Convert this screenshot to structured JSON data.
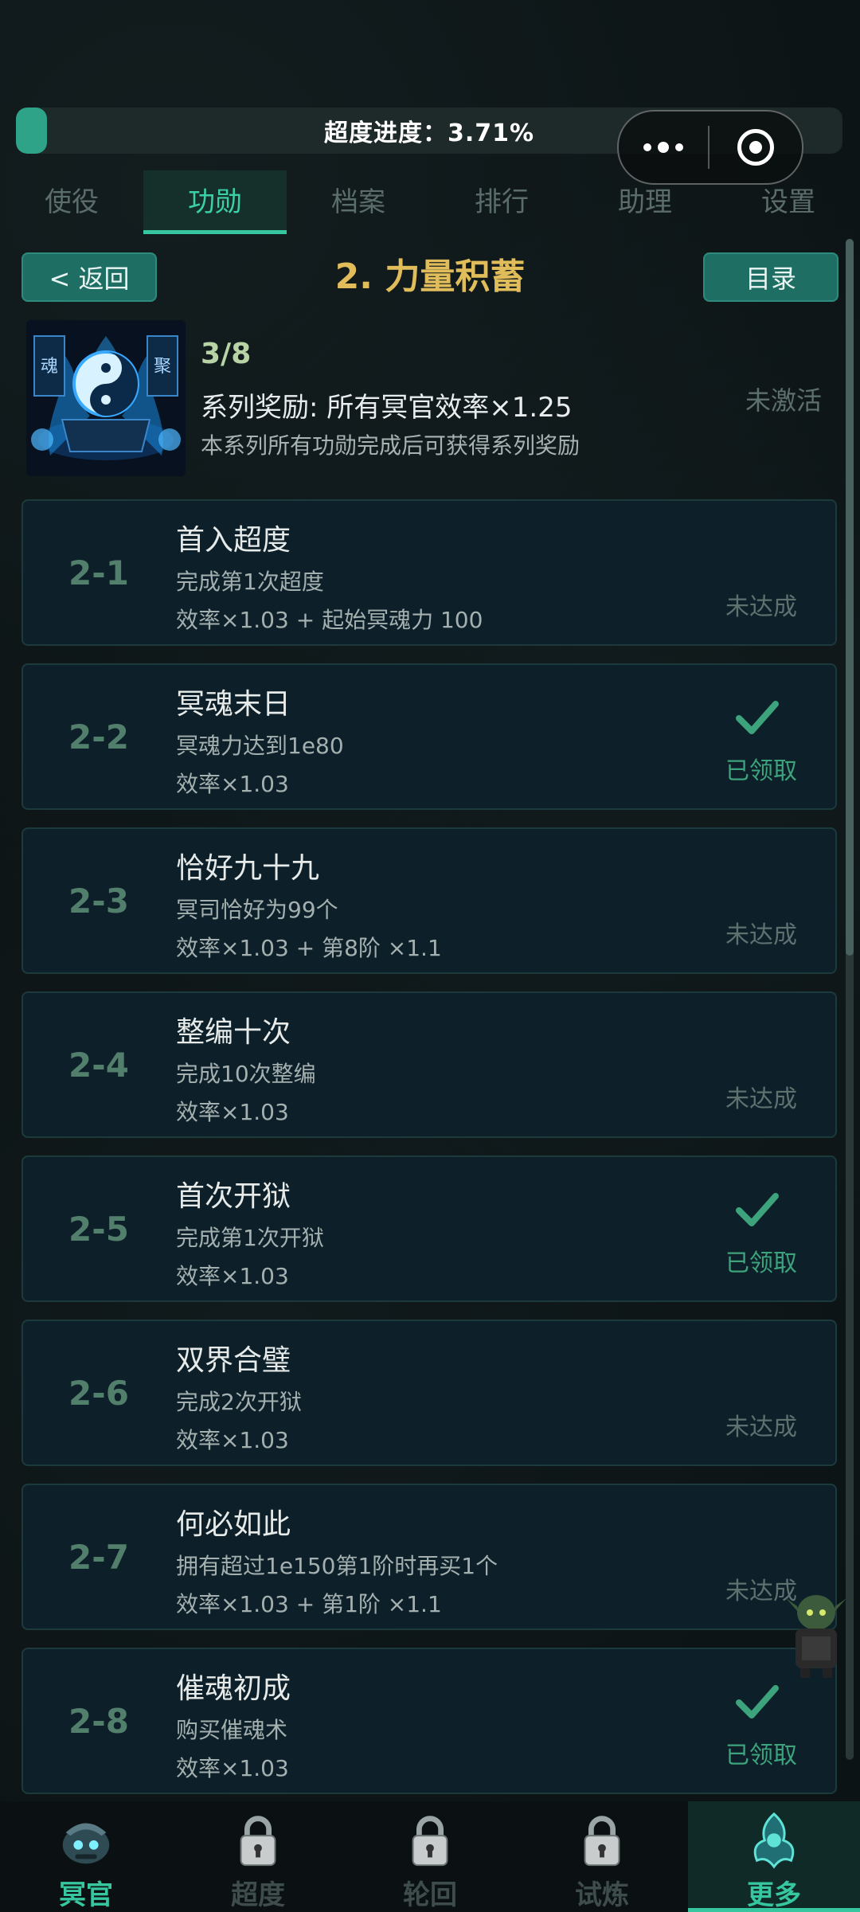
{
  "progress": {
    "label": "超度进度：3.71%",
    "value_percent": 3.71
  },
  "tabs": [
    {
      "label": "使役",
      "active": false
    },
    {
      "label": "功勋",
      "active": true
    },
    {
      "label": "档案",
      "active": false
    },
    {
      "label": "排行",
      "active": false
    },
    {
      "label": "助理",
      "active": false
    },
    {
      "label": "设置",
      "active": false
    }
  ],
  "header": {
    "back_label": "< 返回",
    "title": "2. 力量积蓄",
    "menu_label": "目录"
  },
  "series": {
    "count": "3/8",
    "reward": "系列奖励: 所有冥官效率×1.25",
    "note": "本系列所有功勋完成后可获得系列奖励",
    "status": "未激活",
    "image_glyphs": [
      "魂",
      "聚"
    ]
  },
  "achievements": [
    {
      "id": "2-1",
      "title": "首入超度",
      "desc": "完成第1次超度",
      "reward": "效率×1.03 + 起始冥魂力 100",
      "status": "未达成",
      "claimed": false
    },
    {
      "id": "2-2",
      "title": "冥魂末日",
      "desc": "冥魂力达到1e80",
      "reward": "效率×1.03",
      "status": "已领取",
      "claimed": true
    },
    {
      "id": "2-3",
      "title": "恰好九十九",
      "desc": "冥司恰好为99个",
      "reward": "效率×1.03 + 第8阶 ×1.1",
      "status": "未达成",
      "claimed": false
    },
    {
      "id": "2-4",
      "title": "整编十次",
      "desc": "完成10次整编",
      "reward": "效率×1.03",
      "status": "未达成",
      "claimed": false
    },
    {
      "id": "2-5",
      "title": "首次开狱",
      "desc": "完成第1次开狱",
      "reward": "效率×1.03",
      "status": "已领取",
      "claimed": true
    },
    {
      "id": "2-6",
      "title": "双界合璧",
      "desc": "完成2次开狱",
      "reward": "效率×1.03",
      "status": "未达成",
      "claimed": false
    },
    {
      "id": "2-7",
      "title": "何必如此",
      "desc": "拥有超过1e150第1阶时再买1个",
      "reward": "效率×1.03 + 第1阶 ×1.1",
      "status": "未达成",
      "claimed": false
    },
    {
      "id": "2-8",
      "title": "催魂初成",
      "desc": "购买催魂术",
      "reward": "效率×1.03",
      "status": "已领取",
      "claimed": true
    }
  ],
  "bottom_nav": [
    {
      "label": "冥官",
      "icon": "underworld-officer-icon",
      "locked": false,
      "active": false
    },
    {
      "label": "超度",
      "icon": "lock-icon",
      "locked": true,
      "active": false
    },
    {
      "label": "轮回",
      "icon": "lock-icon",
      "locked": true,
      "active": false
    },
    {
      "label": "试炼",
      "icon": "lock-icon",
      "locked": true,
      "active": false
    },
    {
      "label": "更多",
      "icon": "more-emblem-icon",
      "locked": false,
      "active": true
    }
  ],
  "colors": {
    "accent": "#36c6a0",
    "title_gold": "#e0bd5a",
    "claimed_green": "#3da37c",
    "card_bg": "#0d1f28"
  }
}
